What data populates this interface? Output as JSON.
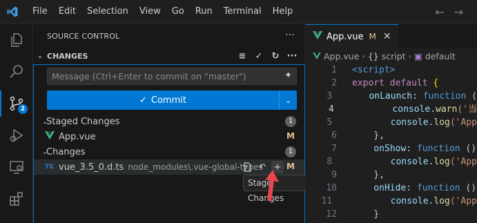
{
  "menu": {
    "items": [
      {
        "label": "File"
      },
      {
        "label": "Edit"
      },
      {
        "label": "Selection"
      },
      {
        "label": "View"
      },
      {
        "label": "Go"
      },
      {
        "label": "Run"
      },
      {
        "label": "Terminal"
      },
      {
        "label": "Help"
      }
    ]
  },
  "activity_bar": {
    "scm_badge": "2"
  },
  "sidebar": {
    "title": "SOURCE CONTROL",
    "section_title": "CHANGES",
    "commit_placeholder": "Message (Ctrl+Enter to commit on \"master\")",
    "commit_label": "Commit",
    "staged": {
      "label": "Staged Changes",
      "count": "1",
      "files": [
        {
          "name": "App.vue",
          "status": "M"
        }
      ]
    },
    "changes": {
      "label": "Changes",
      "count": "1",
      "files": [
        {
          "name": "vue_3.5_0.d.ts",
          "path": "node_modules\\.vue-global-types",
          "status": "M",
          "icon_text": "TS"
        }
      ]
    },
    "tooltip": "Stage Changes"
  },
  "editor": {
    "tab_label": "App.vue",
    "tab_status": "M",
    "breadcrumbs": [
      "App.vue",
      "script",
      "default"
    ],
    "lines": [
      {
        "n": "1",
        "parts": [
          {
            "t": "<script>",
            "c": "kw"
          }
        ]
      },
      {
        "n": "2",
        "parts": [
          {
            "t": "export default ",
            "c": "kw2"
          },
          {
            "t": "{",
            "c": "br"
          }
        ]
      },
      {
        "n": "3",
        "parts": [
          {
            "t": "    onLaunch",
            "c": "prop"
          },
          {
            "t": ": ",
            "c": "punc"
          },
          {
            "t": "function",
            "c": "kw"
          },
          {
            "t": " (",
            "c": "punc"
          }
        ]
      },
      {
        "n": "4",
        "parts": [
          {
            "t": "        console",
            "c": "prop"
          },
          {
            "t": ".",
            "c": "punc"
          },
          {
            "t": "warn",
            "c": "fn"
          },
          {
            "t": "('当",
            "c": "str"
          }
        ]
      },
      {
        "n": "5",
        "parts": [
          {
            "t": "        console",
            "c": "prop"
          },
          {
            "t": ".",
            "c": "punc"
          },
          {
            "t": "log",
            "c": "fn"
          },
          {
            "t": "('App",
            "c": "str"
          }
        ]
      },
      {
        "n": "6",
        "parts": [
          {
            "t": "    },",
            "c": "punc"
          }
        ]
      },
      {
        "n": "7",
        "parts": [
          {
            "t": "    onShow",
            "c": "prop"
          },
          {
            "t": ": ",
            "c": "punc"
          },
          {
            "t": "function",
            "c": "kw"
          },
          {
            "t": " ()",
            "c": "punc"
          }
        ]
      },
      {
        "n": "8",
        "parts": [
          {
            "t": "        console",
            "c": "prop"
          },
          {
            "t": ".",
            "c": "punc"
          },
          {
            "t": "log",
            "c": "fn"
          },
          {
            "t": "('App",
            "c": "str"
          }
        ]
      },
      {
        "n": "9",
        "parts": [
          {
            "t": "    },",
            "c": "punc"
          }
        ]
      },
      {
        "n": "10",
        "parts": [
          {
            "t": "    onHide",
            "c": "prop"
          },
          {
            "t": ": ",
            "c": "punc"
          },
          {
            "t": "function",
            "c": "kw"
          },
          {
            "t": " ()",
            "c": "punc"
          }
        ]
      },
      {
        "n": "11",
        "parts": [
          {
            "t": "        console",
            "c": "prop"
          },
          {
            "t": ".",
            "c": "punc"
          },
          {
            "t": "log",
            "c": "fn"
          },
          {
            "t": "('App",
            "c": "str"
          }
        ]
      },
      {
        "n": "12",
        "parts": [
          {
            "t": "    }",
            "c": "punc"
          }
        ]
      }
    ],
    "current_line": "4"
  },
  "colors": {
    "accent": "#0078d4",
    "modified": "#e2c08d",
    "vue_green": "#41b883"
  }
}
